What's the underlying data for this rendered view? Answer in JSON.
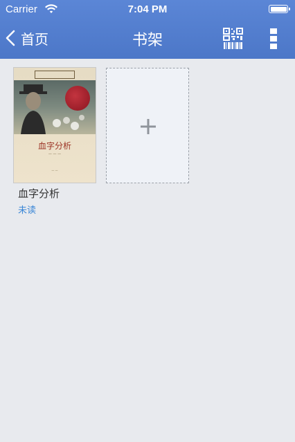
{
  "status_bar": {
    "carrier": "Carrier",
    "time": "7:04 PM"
  },
  "nav": {
    "back_label": "首页",
    "title": "书架"
  },
  "shelf": {
    "books": [
      {
        "title": "血字分析",
        "status": "未读",
        "cover": {
          "title": "血字分析",
          "seal_text": "Sherlock Holmes"
        }
      }
    ]
  },
  "colors": {
    "nav_bar": "#5580d0",
    "status_text": "#3a86d6",
    "background": "#e8eaee"
  },
  "icons": {
    "back": "chevron-left",
    "qr": "qr-code",
    "menu": "vertical-dots",
    "add": "plus"
  }
}
